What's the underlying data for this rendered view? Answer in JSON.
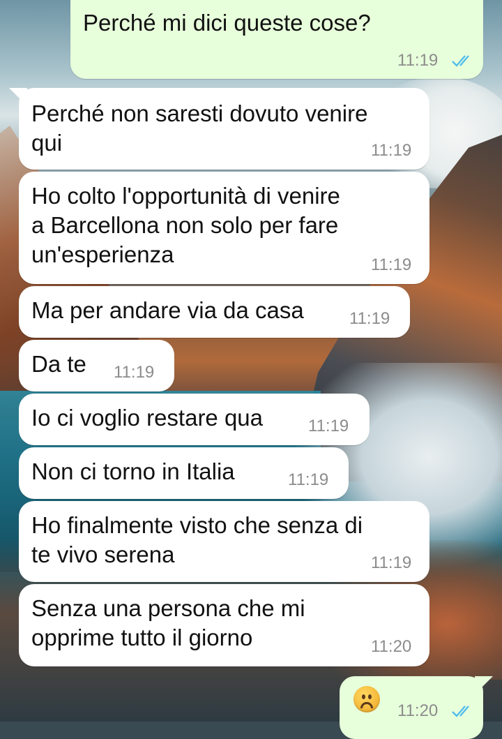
{
  "messages": [
    {
      "id": "m1",
      "dir": "out",
      "lines": [
        "Perché mi dici queste cose?"
      ],
      "time": "11:19",
      "status": "read"
    },
    {
      "id": "m2",
      "dir": "in",
      "lines": [
        "Perché non saresti dovuto venire",
        "qui"
      ],
      "time": "11:19"
    },
    {
      "id": "m3",
      "dir": "in",
      "lines": [
        "Ho colto l'opportunità di venire",
        "a Barcellona non solo per fare",
        "un'esperienza"
      ],
      "time": "11:19"
    },
    {
      "id": "m4",
      "dir": "in",
      "lines": [
        "Ma per andare via da casa"
      ],
      "time": "11:19"
    },
    {
      "id": "m5",
      "dir": "in",
      "lines": [
        "Da te"
      ],
      "time": "11:19"
    },
    {
      "id": "m6",
      "dir": "in",
      "lines": [
        "Io ci voglio restare qua"
      ],
      "time": "11:19"
    },
    {
      "id": "m7",
      "dir": "in",
      "lines": [
        "Non ci torno in Italia"
      ],
      "time": "11:19"
    },
    {
      "id": "m8",
      "dir": "in",
      "lines": [
        "Ho finalmente visto che senza di",
        "te vivo serena"
      ],
      "time": "11:19"
    },
    {
      "id": "m9",
      "dir": "in",
      "lines": [
        "Senza una persona che mi",
        "opprime tutto il giorno"
      ],
      "time": "11:20"
    },
    {
      "id": "m10",
      "dir": "out",
      "emoji": "frowning-face-emoji",
      "time": "11:20",
      "status": "read"
    }
  ],
  "colors": {
    "incoming": "#ffffff",
    "outgoing": "#e7ffdb",
    "read_ticks": "#53bdeb",
    "time": "#8c8c8c"
  }
}
